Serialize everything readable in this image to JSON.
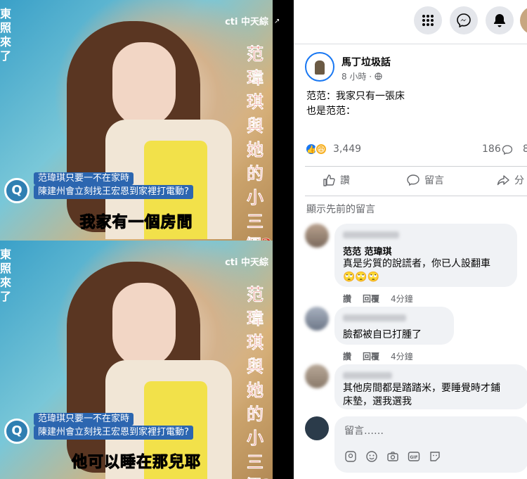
{
  "meme": {
    "logo": "cti 中天綜",
    "vertical_title": "范瑋琪與她的小三們?!",
    "left_tag": "東照來了",
    "banner_line1": "范瑋琪只要一不在家時",
    "banner_line2": "陳建州會立刻找王宏恩到家裡打電動?",
    "caption_top": "我家有一個房間",
    "caption_bottom": "他可以睡在那兒耶"
  },
  "post": {
    "page_name": "馬丁垃圾話",
    "time": "8 小時",
    "privacy_icon": "globe-icon",
    "text_line1": "范范：我家只有一張床",
    "text_line2": "也是范范：",
    "reaction_count": "3,449",
    "comment_count": "186",
    "share_count": "8",
    "actions": {
      "like": "讚",
      "comment": "留言",
      "share": "分"
    },
    "show_previous": "顯示先前的留言"
  },
  "comments": [
    {
      "tag": "范范 范瑋琪",
      "text": "真是劣質的說謊者，你已人設翻車",
      "emoji": "🙄🙄🙄",
      "like": "讚",
      "reply": "回覆",
      "time": "4分鐘"
    },
    {
      "text": "臉都被自已打腫了",
      "like": "讚",
      "reply": "回覆",
      "time": "4分鐘"
    },
    {
      "text_line1": "其他房間都是踏踏米，要睡覺時才鋪",
      "text_line2": "床墊，選我選我"
    }
  ],
  "composer": {
    "placeholder": "留言……"
  },
  "colors": {
    "accent": "#1877f2",
    "secondary_text": "#65676b",
    "bubble": "#f0f2f5"
  }
}
